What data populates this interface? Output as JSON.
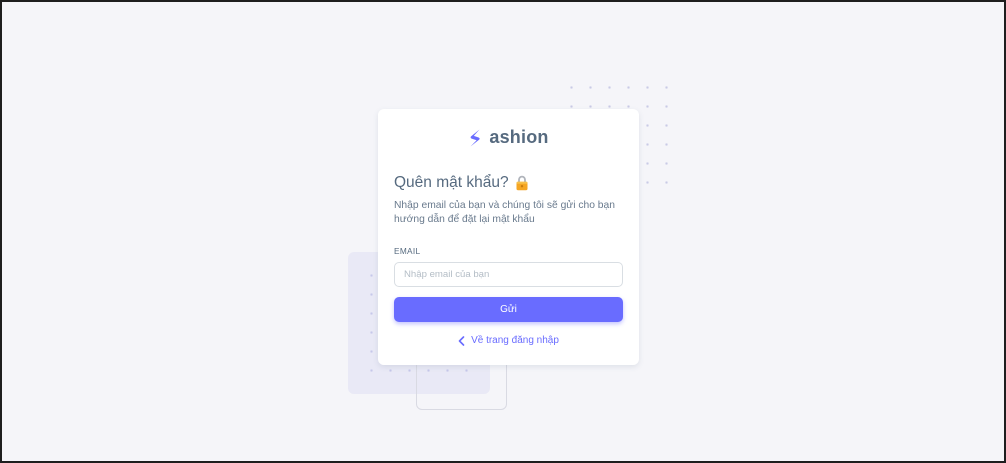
{
  "brand": {
    "name": "ashion",
    "icon": "s-logo-icon"
  },
  "page": {
    "title": "Quên mật khẩu?",
    "title_icon": "lock-icon",
    "description": "Nhập email của bạn và chúng tôi sẽ gửi cho bạn hướng dẫn để đặt lại mật khẩu"
  },
  "form": {
    "email_label": "EMAIL",
    "email_value": "",
    "email_placeholder": "Nhập email của bạn",
    "submit_label": "Gửi"
  },
  "back_link": {
    "label": "Về trang đăng nhập",
    "icon": "chevron-left-icon"
  },
  "colors": {
    "primary": "#696cff",
    "heading": "#566a7f",
    "body_text": "#697a8d",
    "background": "#f5f5f9",
    "lock": "#f5a623"
  }
}
